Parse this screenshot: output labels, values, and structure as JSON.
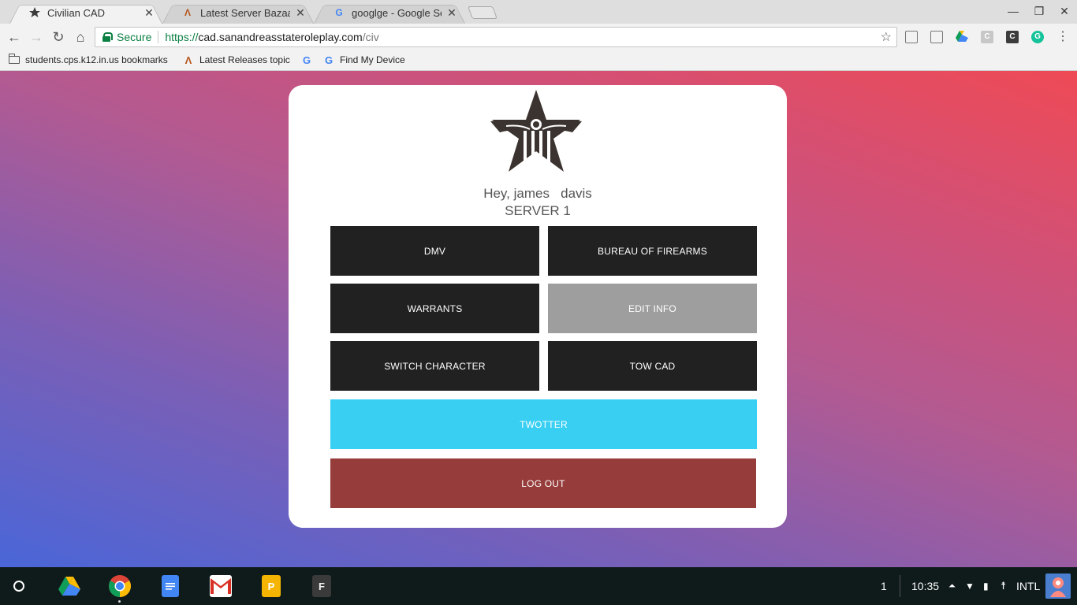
{
  "browser": {
    "tabs": [
      {
        "title": "Civilian CAD",
        "icon": "star-badge-icon",
        "active": true
      },
      {
        "title": "Latest Server Bazaar top",
        "icon": "bazaar-a-icon",
        "active": false
      },
      {
        "title": "googlge - Google Search",
        "icon": "google-g-icon",
        "active": false
      }
    ],
    "address": {
      "secure_label": "Secure",
      "scheme": "https://",
      "host": "cad.sanandreasstateroleplay.com",
      "path": "/civ"
    },
    "bookmarks": [
      {
        "label": "students.cps.k12.in.us bookmarks",
        "icon": "folder-icon"
      },
      {
        "label": "Latest Releases topic",
        "icon": "bazaar-a-icon"
      },
      {
        "label": "",
        "icon": "google-g-icon"
      },
      {
        "label": "Find My Device",
        "icon": "google-g-icon"
      }
    ]
  },
  "card": {
    "greeting": "Hey, james   davis",
    "server": "SERVER 1",
    "buttons": {
      "dmv": "DMV",
      "firearms": "BUREAU OF FIREARMS",
      "warrants": "WARRANTS",
      "edit_info": "EDIT INFO",
      "switch_character": "SWITCH CHARACTER",
      "tow_cad": "TOW CAD",
      "twotter": "TWOTTER",
      "logout": "LOG OUT"
    }
  },
  "shelf": {
    "apps": [
      {
        "name": "Google Drive",
        "icon": "drive-icon"
      },
      {
        "name": "Chrome",
        "icon": "chrome-icon"
      },
      {
        "name": "Google Docs",
        "icon": "docs-icon"
      },
      {
        "name": "Gmail",
        "icon": "gmail-icon"
      },
      {
        "letter": "P",
        "icon": "p-app-icon"
      },
      {
        "letter": "F",
        "icon": "f-app-icon"
      }
    ],
    "tray": {
      "notification_count": "1",
      "time": "10:35",
      "input_method": "INTL"
    }
  },
  "colors": {
    "button_dark": "#212121",
    "button_gray": "#9e9e9e",
    "button_cyan": "#38cff2",
    "button_red": "#963c3a",
    "secure_green": "#0b8043"
  }
}
